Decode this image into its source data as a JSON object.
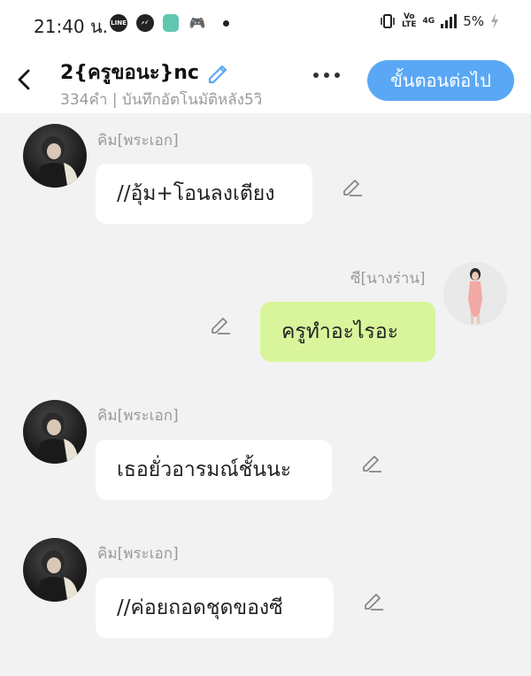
{
  "status_bar": {
    "time": "21:40 น.",
    "icons": [
      "line-icon",
      "messenger-icon",
      "app-icon",
      "gamepad-icon"
    ],
    "network": "4G",
    "volte_top": "Vo",
    "volte_bottom": "LTE",
    "battery": "5%"
  },
  "header": {
    "title": "2{ครูขอนะ}nc",
    "subtitle": "334คำ | บันทึกอัตโนมัติหลัง5วิ",
    "next_button": "ขั้นตอนต่อไป"
  },
  "messages": [
    {
      "sender": "คิม[พระเอก]",
      "text": "//อุ้ม+โอนลงเตียง",
      "side": "left"
    },
    {
      "sender": "ซี[นางร่าน]",
      "text": "ครูทำอะไรอะ",
      "side": "right"
    },
    {
      "sender": "คิม[พระเอก]",
      "text": "เธอยั่วอารมณ์ชั้นนะ",
      "side": "left"
    },
    {
      "sender": "คิม[พระเอก]",
      "text": "//ค่อยถอดชุดของซี",
      "side": "left"
    }
  ],
  "colors": {
    "accent": "#5aa8f5",
    "right_bubble": "#d8f59c",
    "left_bubble": "#ffffff",
    "background": "#f2f2f2"
  }
}
